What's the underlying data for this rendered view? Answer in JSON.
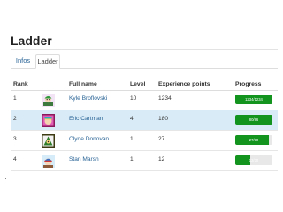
{
  "page": {
    "title": "Ladder"
  },
  "tabs": [
    {
      "label": "Infos",
      "active": false
    },
    {
      "label": "Ladder",
      "active": true
    }
  ],
  "table": {
    "headers": {
      "rank": "Rank",
      "full_name": "Full name",
      "level": "Level",
      "experience_points": "Experience points",
      "progress": "Progress"
    },
    "rows": [
      {
        "rank": "1",
        "full_name": "Kyle Broflovski",
        "level": "10",
        "xp": "1234",
        "progress_label": "1234/1234",
        "progress_fraction": 1.0,
        "avatar_icon": "kyle-avatar-icon"
      },
      {
        "rank": "2",
        "full_name": "Eric Cartman",
        "level": "4",
        "xp": "180",
        "progress_label": "80/86",
        "progress_fraction": 1.0,
        "avatar_icon": "cartman-avatar-icon"
      },
      {
        "rank": "3",
        "full_name": "Clyde Donovan",
        "level": "1",
        "xp": "27",
        "progress_label": "27/30",
        "progress_fraction": 0.9,
        "avatar_icon": "clyde-avatar-icon"
      },
      {
        "rank": "4",
        "full_name": "Stan Marsh",
        "level": "1",
        "xp": "12",
        "progress_label": "12/30",
        "progress_fraction": 0.4,
        "avatar_icon": "stan-avatar-icon"
      }
    ]
  },
  "colors": {
    "accent": "#2a6496",
    "progress_fill": "#12941f",
    "row_highlight": "#d9ebf6"
  }
}
